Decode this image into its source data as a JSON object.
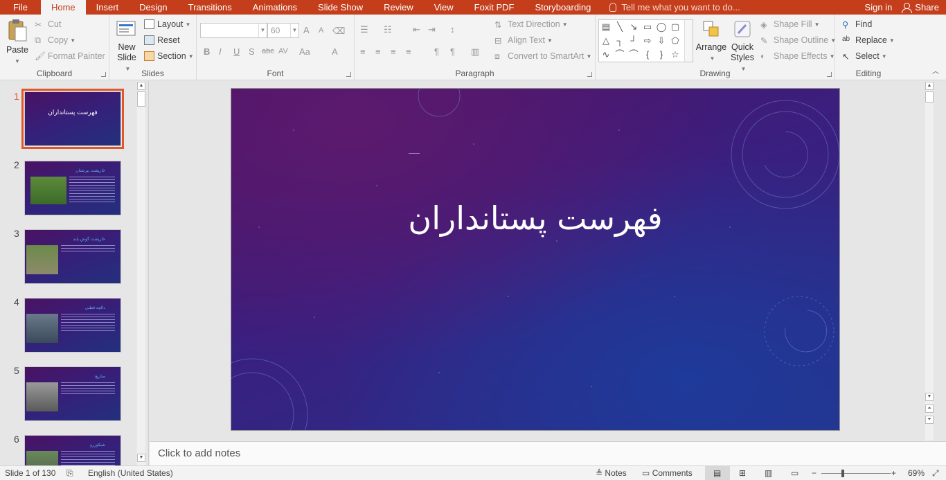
{
  "tabs": {
    "file": "File",
    "items": [
      "Home",
      "Insert",
      "Design",
      "Transitions",
      "Animations",
      "Slide Show",
      "Review",
      "View",
      "Foxit PDF",
      "Storyboarding"
    ],
    "tell_me": "Tell me what you want to do...",
    "sign_in": "Sign in",
    "share": "Share"
  },
  "clipboard": {
    "paste": "Paste",
    "cut": "Cut",
    "copy": "Copy",
    "format_painter": "Format Painter",
    "label": "Clipboard"
  },
  "slides": {
    "new_slide_line1": "New",
    "new_slide_line2": "Slide",
    "layout": "Layout",
    "reset": "Reset",
    "section": "Section",
    "label": "Slides"
  },
  "font": {
    "font_name": "",
    "font_size": "60",
    "label": "Font"
  },
  "paragraph": {
    "text_direction": "Text Direction",
    "align_text": "Align Text",
    "convert_smartart": "Convert to SmartArt",
    "label": "Paragraph"
  },
  "drawing": {
    "arrange": "Arrange",
    "quick_styles_line1": "Quick",
    "quick_styles_line2": "Styles",
    "shape_fill": "Shape Fill",
    "shape_outline": "Shape Outline",
    "shape_effects": "Shape Effects",
    "label": "Drawing"
  },
  "editing": {
    "find": "Find",
    "replace": "Replace",
    "select": "Select",
    "label": "Editing"
  },
  "thumbnails": [
    {
      "num": "1",
      "title": "فهرست پستانداران"
    },
    {
      "num": "2",
      "title": "خارپشت بیرشتان"
    },
    {
      "num": "3",
      "title": "خارپشت گوش بلند"
    },
    {
      "num": "4",
      "title": "دالچه قطبی"
    },
    {
      "num": "5",
      "title": "صاریغ"
    },
    {
      "num": "6",
      "title": "شبکوررو"
    }
  ],
  "slide": {
    "title": "فهرست پستانداران"
  },
  "notes": {
    "placeholder": "Click to add notes"
  },
  "status": {
    "slide_info": "Slide 1 of 130",
    "language": "English (United States)",
    "notes": "Notes",
    "comments": "Comments",
    "zoom": "69%"
  }
}
